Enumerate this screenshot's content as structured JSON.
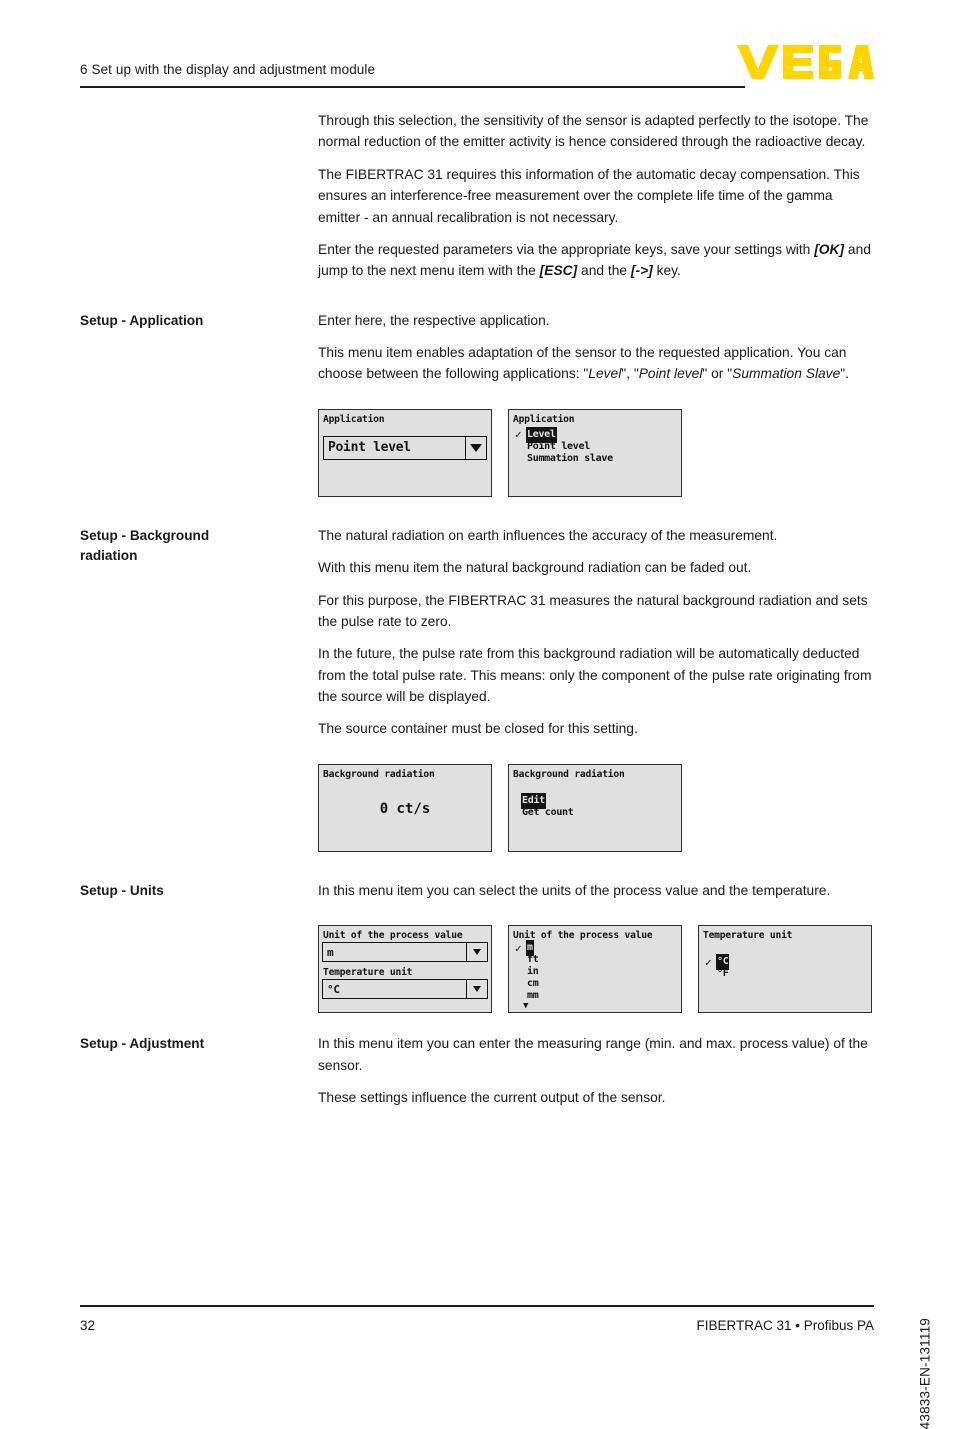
{
  "header": {
    "chapter_title": "6 Set up with the display and adjustment module",
    "logo_text": "VEGA",
    "logo_color": "#FFD400"
  },
  "intro": {
    "paragraphs": [
      "Through this selection, the sensitivity of the sensor is adapted perfectly to the isotope. The normal reduction of the emitter activity is hence considered through the radioactive decay.",
      "The FIBERTRAC 31 requires this information of the automatic decay compensation. This ensures an interference-free measurement over the complete life time of the gamma emitter - an annual recalibration is not necessary."
    ],
    "keys_paragraph": {
      "part1": "Enter the requested parameters via the appropriate keys, save your settings with ",
      "key_ok": "[OK]",
      "part2": " and jump to the next menu item with the ",
      "key_esc": "[ESC]",
      "part3": " and the ",
      "key_arrow": "[->]",
      "part4": " key."
    }
  },
  "sections": {
    "application": {
      "label": "Setup - Application",
      "p1": "Enter here, the respective application.",
      "p2": {
        "part1": "This menu item enables adaptation of the sensor to the requested application. You can choose between the following applications: \"",
        "opt1": "Level",
        "part2": "\", \"",
        "opt2": "Point level",
        "part3": "\" or \"",
        "opt3": "Summation Slave",
        "part4": "\"."
      },
      "lcd_left": {
        "title": "Application",
        "value": "Point level",
        "arrow_icon": "chevron-down-icon"
      },
      "lcd_right": {
        "title": "Application",
        "options": [
          {
            "label": "Level",
            "checked": true,
            "selected": true
          },
          {
            "label": "Point level",
            "checked": false,
            "selected": false
          },
          {
            "label": "Summation slave",
            "checked": false,
            "selected": false
          }
        ]
      }
    },
    "background_radiation": {
      "label_line1": "Setup - Background",
      "label_line2": "radiation",
      "paragraphs": [
        "The natural radiation on earth influences the accuracy of the measurement.",
        "With this menu item the natural background radiation can be faded out.",
        "For this purpose, the FIBERTRAC 31 measures the natural background radiation and sets the pulse rate to zero.",
        "In the future, the pulse rate from this background radiation will be automatically deducted from the total pulse rate. This means: only the component of the pulse rate originating from the source will be displayed.",
        "The source container must be closed for this setting."
      ],
      "lcd_left": {
        "title": "Background radiation",
        "value": "0 ct/s"
      },
      "lcd_right": {
        "title": "Background radiation",
        "options": [
          {
            "label": "Edit",
            "checked": false,
            "selected": true
          },
          {
            "label": "Get count",
            "checked": false,
            "selected": false
          }
        ]
      }
    },
    "units": {
      "label": "Setup - Units",
      "p1": "In this menu item you can select the units of the process value and the temperature.",
      "lcd_left": {
        "title": "Unit of the process value",
        "value": "m",
        "sublabel": "Temperature unit",
        "subvalue": "°C",
        "arrow_icon": "chevron-down-icon"
      },
      "lcd_middle": {
        "title": "Unit of the process value",
        "options": [
          {
            "label": "m",
            "checked": true,
            "selected": true
          },
          {
            "label": "ft",
            "checked": false,
            "selected": false
          },
          {
            "label": "in",
            "checked": false,
            "selected": false
          },
          {
            "label": "cm",
            "checked": false,
            "selected": false
          },
          {
            "label": "mm",
            "checked": false,
            "selected": false
          }
        ],
        "more_indicator": "▼"
      },
      "lcd_right": {
        "title": "Temperature unit",
        "options": [
          {
            "label": "°C",
            "checked": true,
            "selected": true
          },
          {
            "label": "°F",
            "checked": false,
            "selected": false
          }
        ]
      }
    },
    "adjustment": {
      "label": "Setup - Adjustment",
      "paragraphs": [
        "In this menu item you can enter the measuring range (min. and max. process value) of the sensor.",
        "These settings influence the current output of the sensor."
      ]
    }
  },
  "side_code": "43833-EN-131119",
  "footer": {
    "page_number": "32",
    "document_title": "FIBERTRAC 31 • Profibus PA"
  }
}
